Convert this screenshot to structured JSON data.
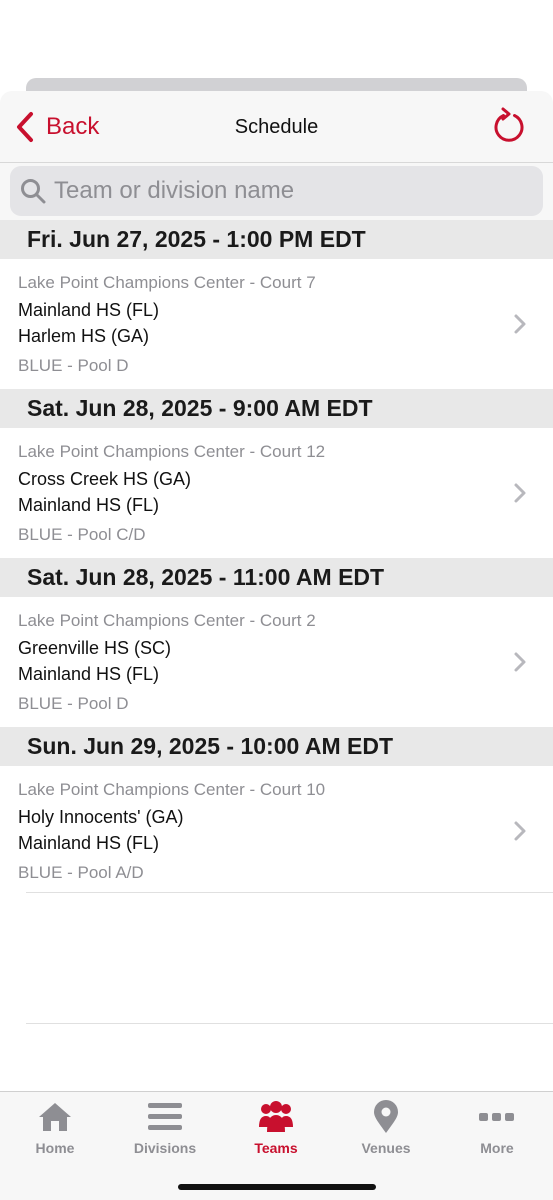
{
  "nav": {
    "back_label": "Back",
    "title": "Schedule"
  },
  "search": {
    "placeholder": "Team or division name",
    "value": ""
  },
  "games": [
    {
      "header": "Fri. Jun 27, 2025 - 1:00 PM EDT",
      "venue": "Lake Point Champions Center - Court 7",
      "team1": "Mainland HS (FL)",
      "team2": "Harlem HS (GA)",
      "division": "BLUE - Pool D"
    },
    {
      "header": "Sat. Jun 28, 2025 - 9:00 AM EDT",
      "venue": "Lake Point Champions Center - Court 12",
      "team1": "Cross Creek HS (GA)",
      "team2": "Mainland HS (FL)",
      "division": "BLUE - Pool C/D"
    },
    {
      "header": "Sat. Jun 28, 2025 - 11:00 AM EDT",
      "venue": "Lake Point Champions Center - Court 2",
      "team1": "Greenville HS (SC)",
      "team2": "Mainland HS (FL)",
      "division": "BLUE - Pool D"
    },
    {
      "header": "Sun. Jun 29, 2025 - 10:00 AM EDT",
      "venue": "Lake Point Champions Center - Court 10",
      "team1": "Holy Innocents' (GA)",
      "team2": "Mainland HS (FL)",
      "division": "BLUE - Pool A/D"
    }
  ],
  "tabs": [
    {
      "label": "Home",
      "icon": "house-icon",
      "active": false
    },
    {
      "label": "Divisions",
      "icon": "list-icon",
      "active": false
    },
    {
      "label": "Teams",
      "icon": "group-icon",
      "active": true
    },
    {
      "label": "Venues",
      "icon": "map-pin-icon",
      "active": false
    },
    {
      "label": "More",
      "icon": "ellipsis-icon",
      "active": false
    }
  ],
  "colors": {
    "accent": "#c8102e",
    "inactive": "#8e8e93",
    "header_bg": "#e8e8e8"
  }
}
